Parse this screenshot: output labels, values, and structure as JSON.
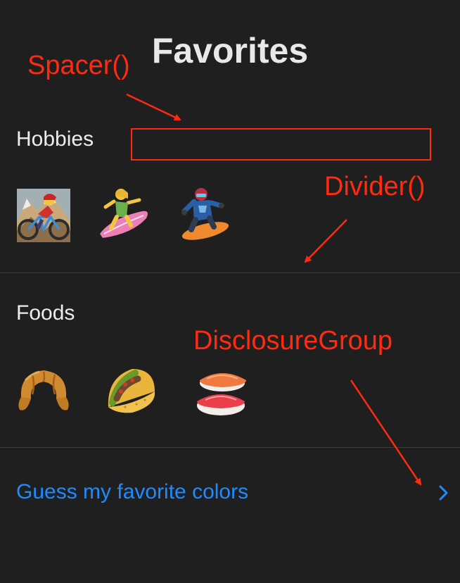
{
  "title": "Favorites",
  "sections": [
    {
      "label": "Hobbies",
      "items": [
        "woman-mountain-biking-icon",
        "woman-surfing-icon",
        "snowboarder-icon"
      ]
    },
    {
      "label": "Foods",
      "items": [
        "croissant-icon",
        "taco-icon",
        "sushi-icon"
      ]
    }
  ],
  "disclosure": {
    "label": "Guess my favorite colors",
    "icon": "chevron-right-icon"
  },
  "annotations": {
    "spacer": "Spacer()",
    "divider": "Divider()",
    "disclosure_group": "DisclosureGroup"
  },
  "colors": {
    "background": "#1f1f1f",
    "accent": "#1f8bff",
    "annotation": "#ff2a10",
    "divider": "#3a3a3a"
  }
}
